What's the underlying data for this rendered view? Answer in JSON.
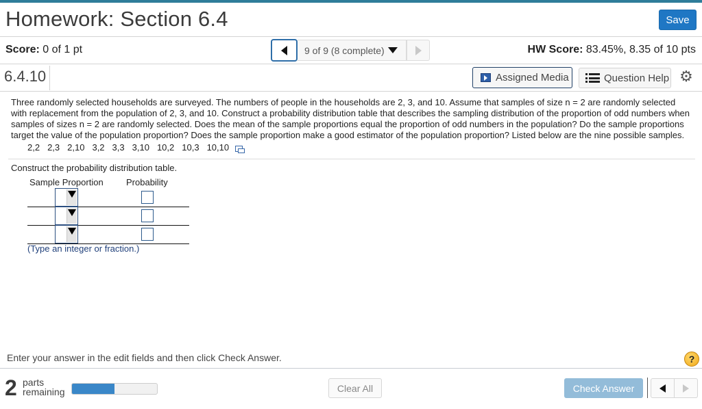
{
  "header": {
    "title": "Homework: Section 6.4",
    "save_label": "Save"
  },
  "score_bar": {
    "score_label": "Score:",
    "score_value": "0 of 1 pt",
    "question_nav": "9 of 9 (8 complete)",
    "hw_score_label": "HW Score:",
    "hw_score_value": "83.45%, 8.35 of 10 pts"
  },
  "question_bar": {
    "question_number": "6.4.10",
    "assigned_media_label": "Assigned Media",
    "question_help_label": "Question Help"
  },
  "question": {
    "text": "Three randomly selected households are surveyed. The numbers of people in the households are 2, 3, and 10. Assume that samples of size n = 2 are randomly selected with replacement from the population of 2, 3, and 10. Construct a probability distribution table that describes the sampling distribution of the proportion of odd numbers when samples of sizes n = 2 are randomly selected. Does the mean of the sample proportions equal the proportion of odd numbers in the population? Do the sample proportions target the value of the population proportion? Does the sample proportion make a good estimator of the population proportion? Listed below are the nine possible samples.",
    "samples": [
      "2,2",
      "2,3",
      "2,10",
      "3,2",
      "3,3",
      "3,10",
      "10,2",
      "10,3",
      "10,10"
    ]
  },
  "answer_area": {
    "instruction": "Construct the probability distribution table.",
    "col_sample_proportion": "Sample Proportion",
    "col_probability": "Probability",
    "rows": [
      {
        "sample_proportion": "",
        "probability": ""
      },
      {
        "sample_proportion": "",
        "probability": ""
      },
      {
        "sample_proportion": "",
        "probability": ""
      }
    ],
    "hint": "(Type an integer or fraction.)"
  },
  "footer": {
    "message": "Enter your answer in the edit fields and then click Check Answer.",
    "parts_count": "2",
    "parts_label_line1": "parts",
    "parts_label_line2": "remaining",
    "progress_fraction": 0.5,
    "clear_all_label": "Clear All",
    "check_answer_label": "Check Answer",
    "help_symbol": "?"
  },
  "colors": {
    "accent": "#1f77c4",
    "top_bar": "#2f7d9a",
    "progress_fill": "#3a87c8",
    "check_answer_disabled": "#93bcd9"
  }
}
